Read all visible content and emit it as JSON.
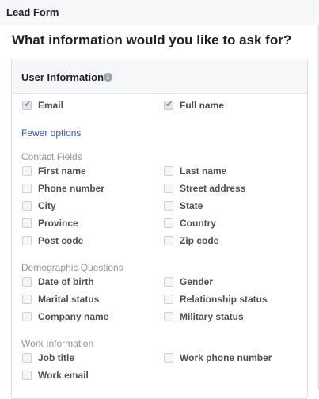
{
  "page": {
    "title": "Lead Form"
  },
  "question": "What information would you like to ask for?",
  "card": {
    "title": "User Information",
    "info_icon": "info-icon",
    "info_glyph": "i"
  },
  "selected_fields": [
    {
      "label": "Email",
      "checked": true
    },
    {
      "label": "Full name",
      "checked": true
    }
  ],
  "toggle_link": "Fewer options",
  "sections": [
    {
      "heading": "Contact Fields",
      "fields": [
        {
          "label": "First name",
          "checked": false
        },
        {
          "label": "Last name",
          "checked": false
        },
        {
          "label": "Phone number",
          "checked": false
        },
        {
          "label": "Street address",
          "checked": false
        },
        {
          "label": "City",
          "checked": false
        },
        {
          "label": "State",
          "checked": false
        },
        {
          "label": "Province",
          "checked": false
        },
        {
          "label": "Country",
          "checked": false
        },
        {
          "label": "Post code",
          "checked": false
        },
        {
          "label": "Zip code",
          "checked": false
        }
      ]
    },
    {
      "heading": "Demographic Questions",
      "fields": [
        {
          "label": "Date of birth",
          "checked": false
        },
        {
          "label": "Gender",
          "checked": false
        },
        {
          "label": "Marital status",
          "checked": false
        },
        {
          "label": "Relationship status",
          "checked": false
        },
        {
          "label": "Company name",
          "checked": false
        },
        {
          "label": "Military status",
          "checked": false
        }
      ]
    },
    {
      "heading": "Work Information",
      "fields": [
        {
          "label": "Job title",
          "checked": false
        },
        {
          "label": "Work phone number",
          "checked": false
        },
        {
          "label": "Work email",
          "checked": false
        }
      ]
    }
  ],
  "checkmark_glyph": "✔"
}
